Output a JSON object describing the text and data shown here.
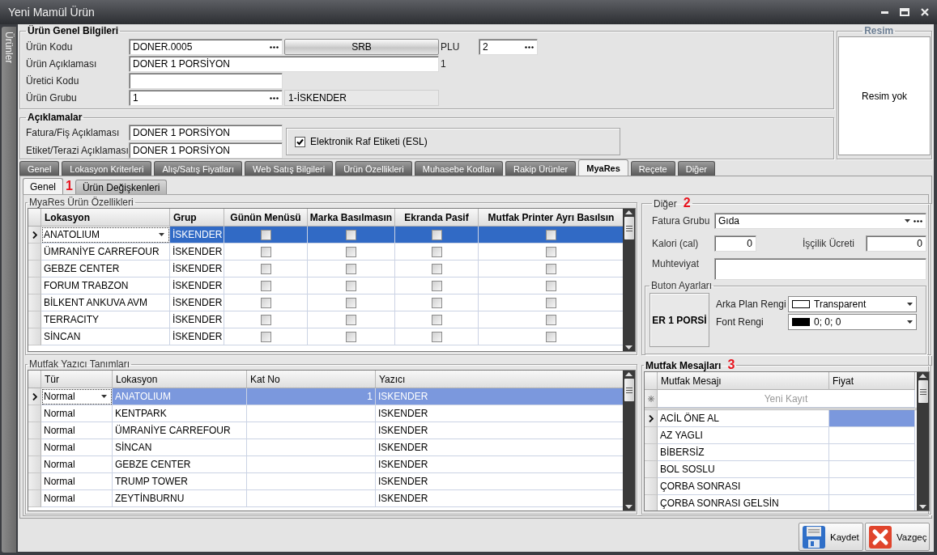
{
  "window": {
    "title": "Yeni Mamül Ürün",
    "side_tab": "Ürünler"
  },
  "general": {
    "legend": "Ürün Genel Bilgileri",
    "code": {
      "label": "Ürün Kodu",
      "value": "DONER.0005"
    },
    "srb_button": "SRB",
    "plu": {
      "label": "PLU",
      "value": "2"
    },
    "description": {
      "label": "Ürün Açıklaması",
      "value": "DONER 1 PORSİYON",
      "note": "1"
    },
    "producer_code": {
      "label": "Üretici Kodu"
    },
    "group": {
      "label": "Ürün Grubu",
      "value": "1",
      "name": "1-İSKENDER"
    }
  },
  "descriptions": {
    "legend": "Açıklamalar",
    "invoice": {
      "label": "Fatura/Fiş Açıklaması",
      "value": "DONER 1 PORSİYON"
    },
    "scale": {
      "label": "Etiket/Terazi Açıklaması",
      "value": "DONER 1 PORSİYON"
    },
    "esl": {
      "label": "Elektronik Raf Etiketi (ESL)",
      "checked": true
    }
  },
  "picture": {
    "legend": "Resim",
    "text": "Resim yok"
  },
  "tabs": [
    {
      "label": "Genel",
      "selected": false
    },
    {
      "label": "Lokasyon Kriterleri",
      "selected": false
    },
    {
      "label": "Alış/Satış Fiyatları",
      "selected": false
    },
    {
      "label": "Web Satış Bilgileri",
      "selected": false
    },
    {
      "label": "Ürün Özellikleri",
      "selected": false
    },
    {
      "label": "Muhasebe Kodları",
      "selected": false
    },
    {
      "label": "Rakip Ürünler",
      "selected": false
    },
    {
      "label": "MyaRes",
      "selected": true
    },
    {
      "label": "Reçete",
      "selected": false
    },
    {
      "label": "Diğer",
      "selected": false
    }
  ],
  "subtabs": {
    "annotation": "1",
    "items": [
      {
        "label": "Genel",
        "selected": true
      },
      {
        "label": "Ürün Değişkenleri",
        "selected": false
      }
    ]
  },
  "features": {
    "legend": "MyaRes Ürün Özellikleri",
    "columns": [
      "Lokasyon",
      "Grup",
      "Günün Menüsü",
      "Marka Basılmasın",
      "Ekranda Pasif",
      "Mutfak Printer Ayrı Basılsın"
    ],
    "rows": [
      {
        "location": "ANATOLIUM",
        "group": "İSKENDER",
        "selected": true,
        "flags": [
          {
            "checked": false
          },
          {
            "checked": false
          },
          {
            "checked": false
          },
          {
            "checked": false
          }
        ]
      },
      {
        "location": "ÜMRANİYE CARREFOUR",
        "group": "İSKENDER",
        "selected": false,
        "flags": [
          {
            "checked": false
          },
          {
            "checked": false
          },
          {
            "checked": false
          },
          {
            "checked": false
          }
        ]
      },
      {
        "location": "GEBZE CENTER",
        "group": "İSKENDER",
        "selected": false,
        "flags": [
          {
            "checked": false
          },
          {
            "checked": false
          },
          {
            "checked": false
          },
          {
            "checked": false
          }
        ]
      },
      {
        "location": "FORUM TRABZON",
        "group": "İSKENDER",
        "selected": false,
        "flags": [
          {
            "checked": false
          },
          {
            "checked": false
          },
          {
            "checked": false
          },
          {
            "checked": false
          }
        ]
      },
      {
        "location": "BİLKENT ANKUVA AVM",
        "group": "İSKENDER",
        "selected": false,
        "flags": [
          {
            "checked": false
          },
          {
            "checked": false
          },
          {
            "checked": false
          },
          {
            "checked": false
          }
        ]
      },
      {
        "location": "TERRACITY",
        "group": "İSKENDER",
        "selected": false,
        "flags": [
          {
            "checked": false
          },
          {
            "checked": false
          },
          {
            "checked": false
          },
          {
            "checked": false
          }
        ]
      },
      {
        "location": "SİNCAN",
        "group": "İSKENDER",
        "selected": false,
        "flags": [
          {
            "checked": false
          },
          {
            "checked": false
          },
          {
            "checked": false
          },
          {
            "checked": false
          }
        ]
      }
    ]
  },
  "printers": {
    "legend": "Mutfak Yazıcı Tanımları",
    "columns": [
      "Tür",
      "Lokasyon",
      "Kat No",
      "Yazıcı"
    ],
    "rows": [
      {
        "type": "Normal",
        "location": "ANATOLIUM",
        "floor": "1",
        "printer": "ISKENDER",
        "selected": true
      },
      {
        "type": "Normal",
        "location": "KENTPARK",
        "printer": "ISKENDER",
        "selected": false
      },
      {
        "type": "Normal",
        "location": "ÜMRANİYE CARREFOUR",
        "printer": "ISKENDER",
        "selected": false
      },
      {
        "type": "Normal",
        "location": "SİNCAN",
        "printer": "ISKENDER",
        "selected": false
      },
      {
        "type": "Normal",
        "location": "GEBZE CENTER",
        "printer": "ISKENDER",
        "selected": false
      },
      {
        "type": "Normal",
        "location": "TRUMP TOWER",
        "printer": "ISKENDER",
        "selected": false
      },
      {
        "type": "Normal",
        "location": "ZEYTİNBURNU",
        "printer": "ISKENDER",
        "selected": false
      }
    ]
  },
  "other": {
    "legend": "Diğer",
    "annotation": "2",
    "invoice_group": {
      "label": "Fatura Grubu",
      "value": "Gıda"
    },
    "calorie": {
      "label": "Kalori (cal)",
      "value": "0"
    },
    "labor": {
      "label": "İşçilik Ücreti",
      "value": "0"
    },
    "contents": {
      "label": "Muhteviyat"
    },
    "button_settings": {
      "legend": "Buton Ayarları",
      "preview": "ER 1 PORSİ",
      "background": {
        "label": "Arka Plan Rengi",
        "value": "Transparent",
        "color": "#ffffff"
      },
      "font": {
        "label": "Font Rengi",
        "value": "0; 0; 0",
        "color": "#000000"
      }
    }
  },
  "messages": {
    "legend": "Mutfak Mesajları",
    "annotation": "3",
    "columns": [
      "Mutfak Mesajı",
      "Fiyat"
    ],
    "new_row": "Yeni Kayıt",
    "rows": [
      {
        "text": "ACİL ÖNE AL",
        "selected": true
      },
      {
        "text": "AZ YAGLI",
        "selected": false
      },
      {
        "text": "BİBERSİZ",
        "selected": false
      },
      {
        "text": "BOL SOSLU",
        "selected": false
      },
      {
        "text": "ÇORBA SONRASI",
        "selected": false
      },
      {
        "text": "ÇORBA SONRASI GELSİN",
        "selected": false
      }
    ]
  },
  "buttons": [
    {
      "label": "Kaydet",
      "kind": "save"
    },
    {
      "label": "Vazgeç",
      "kind": "cancel"
    }
  ]
}
